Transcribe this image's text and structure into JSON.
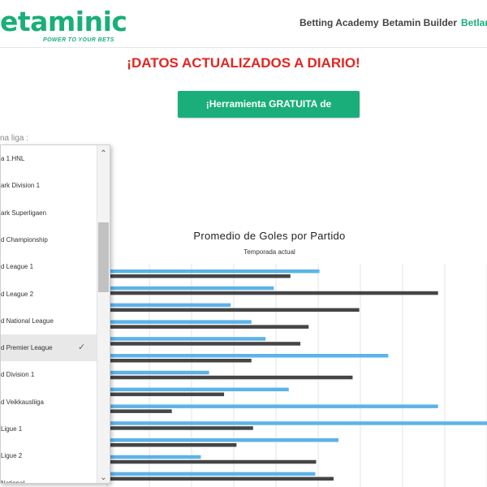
{
  "header": {
    "logo_main": "etaminic",
    "logo_tagline": "POWER TO YOUR BETS",
    "nav": [
      "Betting Academy",
      "Betamin Builder",
      "Betlan"
    ]
  },
  "headline": "¡DATOS ACTUALIZADOS A DIARIO!",
  "cta_label": "¡Herramienta GRATUITA de estadísticas!",
  "select_label": "na liga :",
  "dropdown": {
    "items": [
      "a 1.HNL",
      "ark Division 1",
      "ark Superligaen",
      "d Championship",
      "d League 1",
      "d League 2",
      "d National League",
      "d Premier League",
      "d Division 1",
      "d Veikkausliiga",
      "Ligue 1",
      "Ligue 2",
      "National"
    ],
    "selected_index": 7,
    "check_icon": "check-icon",
    "scroll_up_icon": "chevron-up-icon",
    "scroll_down_icon": "chevron-down-icon"
  },
  "chart_data": {
    "type": "bar",
    "orientation": "horizontal",
    "title": "Promedio de Goles por Partido",
    "subtitle": "Temporada actual",
    "categories": [
      "",
      "",
      "",
      "",
      "",
      "",
      "",
      "",
      "",
      "",
      "",
      "",
      "",
      ""
    ],
    "series": [
      {
        "color": "#5cb3e8",
        "values": [
          2.56,
          2.01,
          1.49,
          1.74,
          1.91,
          3.39,
          1.23,
          2.19,
          3.99,
          4.6,
          2.79,
          1.13,
          2.51,
          2.06
        ]
      },
      {
        "color": "#454545",
        "values": [
          2.21,
          3.99,
          3.04,
          2.43,
          2.33,
          1.74,
          2.96,
          1.41,
          0.78,
          1.76,
          1.56,
          2.52,
          2.73,
          2.33
        ]
      }
    ],
    "grid": true,
    "xlim": [
      0,
      4.6
    ]
  }
}
